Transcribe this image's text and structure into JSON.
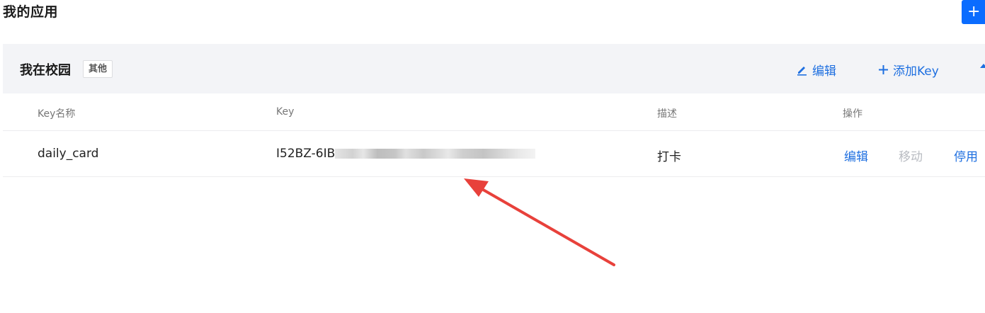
{
  "page": {
    "title": "我的应用"
  },
  "create_button": {
    "icon": "plus-icon",
    "label": "+"
  },
  "app": {
    "name": "我在校园",
    "tag": "其他",
    "edit_label": "编辑",
    "add_key_label": "添加Key"
  },
  "table": {
    "columns": [
      "Key名称",
      "Key",
      "描述",
      "操作"
    ],
    "rows": [
      {
        "name": "daily_card",
        "key_visible": "I52BZ-6IB",
        "description": "打卡",
        "actions": [
          "编辑",
          "移动",
          "停用"
        ]
      }
    ]
  },
  "colors": {
    "accent": "#1e6fe0",
    "primary_button": "#0a6cff",
    "disabled_text": "#b9bcc2",
    "annotation": "#e8413b"
  }
}
